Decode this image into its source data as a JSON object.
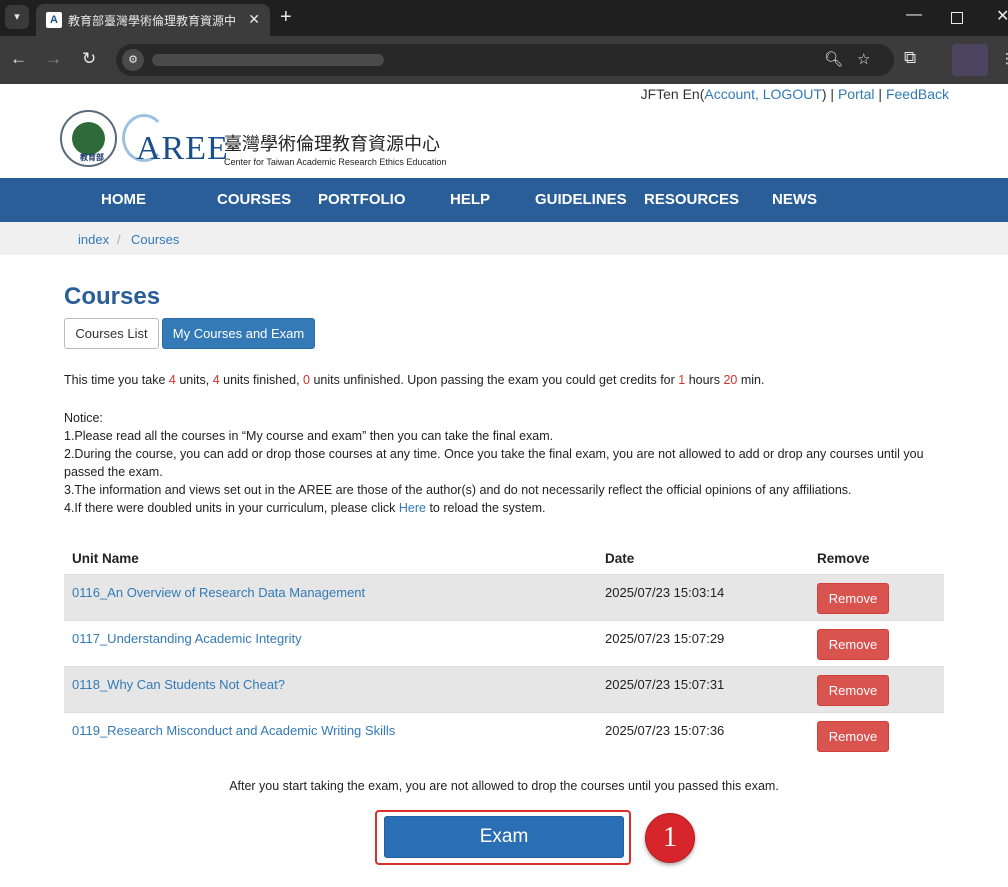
{
  "browser": {
    "tab_title": "教育部臺灣學術倫理教育資源中心",
    "tab_favicon": "AREE",
    "new_tab_icon": "plus-icon",
    "window_controls": [
      "minimize-icon",
      "maximize-icon",
      "close-icon"
    ]
  },
  "userbar": {
    "name": "JFTen En(",
    "account": "Account,",
    "logout": "LOGOUT",
    "close_paren": ") | ",
    "portal": "Portal",
    "sep": " | ",
    "feedback": "FeedBack"
  },
  "logo": {
    "moe_text": "教育部",
    "aree": "AREE",
    "chinese_name": "臺灣學術倫理教育資源中心",
    "english_name": "Center for Taiwan Academic Research Ethics Education"
  },
  "nav": [
    "HOME",
    "COURSES",
    "PORTFOLIO",
    "HELP",
    "GUIDELINES",
    "RESOURCES",
    "NEWS"
  ],
  "breadcrumb": {
    "home": "index",
    "separator": "/",
    "current": "Courses"
  },
  "page_title": "Courses",
  "tabs": {
    "courses_list": "Courses List",
    "my_courses": "My Courses and Exam"
  },
  "summary": {
    "prefix": "This time you take ",
    "units_taken": "4",
    "mid1": " units, ",
    "units_finished": "4",
    "mid2": " units finished, ",
    "units_unfinished": "0",
    "mid3": " units unfinished. Upon passing the exam you could get credits for ",
    "hours": "1",
    "mid4": " hours ",
    "minutes": "20",
    "suffix": " min."
  },
  "notice": {
    "heading": "Notice:",
    "line1": "1.Please read all the courses in “My course and exam” then you can take the final exam.",
    "line2": "2.During the course, you can add or drop those courses at any time. Once you take the final exam, you are not allowed to add or drop any courses until you passed the exam.",
    "line3": "3.The information and views set out in the AREE are those of the author(s) and do not necessarily reflect the official opinions of any affiliations.",
    "line4_prefix": "4.If there were doubled units in your curriculum, please click ",
    "line4_link": "Here",
    "line4_suffix": " to reload the system."
  },
  "table": {
    "headers": {
      "name": "Unit Name",
      "date": "Date",
      "remove": "Remove"
    },
    "rows": [
      {
        "name": "0116_An Overview of Research Data Management",
        "date": "2025/07/23 15:03:14",
        "action": "Remove"
      },
      {
        "name": "0117_Understanding Academic Integrity",
        "date": "2025/07/23 15:07:29",
        "action": "Remove"
      },
      {
        "name": "0118_Why Can Students Not Cheat?",
        "date": "2025/07/23 15:07:31",
        "action": "Remove"
      },
      {
        "name": "0119_Research Misconduct and Academic Writing Skills",
        "date": "2025/07/23 15:07:36",
        "action": "Remove"
      }
    ]
  },
  "after_note": "After you start taking the exam, you are not allowed to drop the courses until you passed this exam.",
  "exam_button": "Exam",
  "step_badge": "1",
  "colors": {
    "nav_bg": "#2a5e98",
    "link": "#337ab7",
    "danger": "#d9534f",
    "highlight": "#d9302c"
  }
}
